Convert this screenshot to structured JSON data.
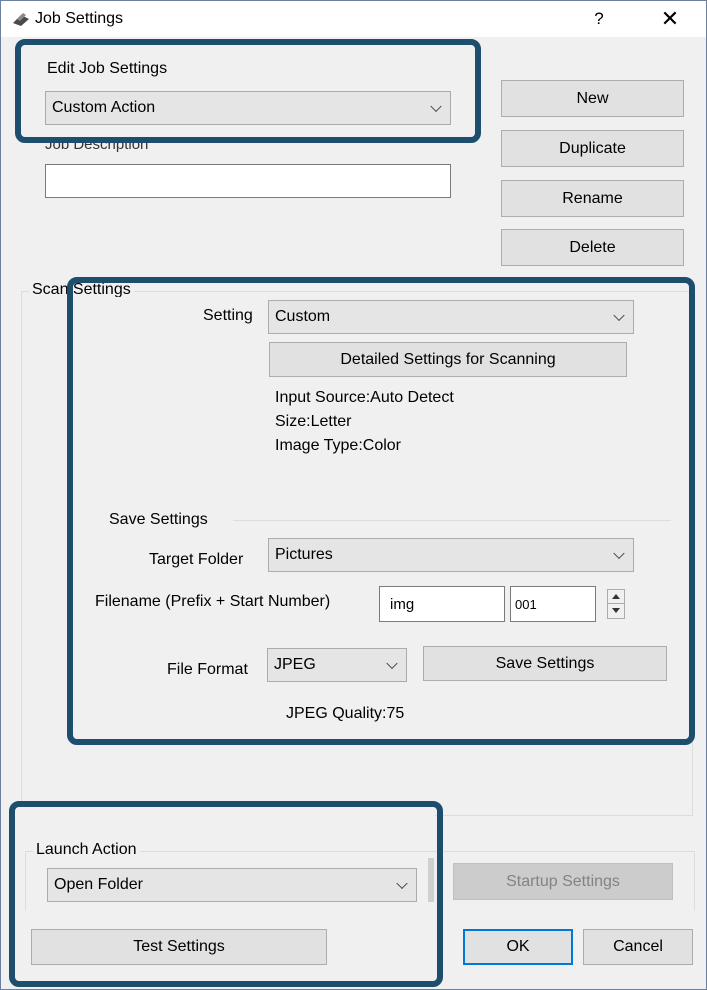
{
  "window": {
    "title": "Job Settings",
    "help_glyph": "?",
    "close_glyph": "✕"
  },
  "edit_job": {
    "label": "Edit Job Settings",
    "selected": "Custom Action"
  },
  "job_description": {
    "label": "Job Description",
    "value": ""
  },
  "job_buttons": {
    "new": "New",
    "duplicate": "Duplicate",
    "rename": "Rename",
    "delete": "Delete"
  },
  "scan_settings": {
    "group_label": "Scan Settings",
    "setting_label": "Setting",
    "setting_value": "Custom",
    "detailed_button": "Detailed Settings for Scanning",
    "info": {
      "input_source": "Input Source:Auto Detect",
      "size": "Size:Letter",
      "image_type": "Image Type:Color"
    }
  },
  "save_settings": {
    "section_label": "Save Settings",
    "target_folder_label": "Target Folder",
    "target_folder_value": "Pictures",
    "filename_label": "Filename (Prefix + Start Number)",
    "prefix_value": "img",
    "start_number_value": "001",
    "file_format_label": "File Format",
    "file_format_value": "JPEG",
    "save_button": "Save Settings",
    "jpeg_quality": "JPEG Quality:75"
  },
  "launch_action": {
    "label": "Launch Action",
    "selected": "Open Folder",
    "startup_button": "Startup Settings"
  },
  "footer": {
    "test_button": "Test Settings",
    "ok_button": "OK",
    "cancel_button": "Cancel"
  },
  "colors": {
    "highlight": "#1d4e6e",
    "dialog_bg": "#f0f0f0",
    "default_button_border": "#0078d7"
  }
}
